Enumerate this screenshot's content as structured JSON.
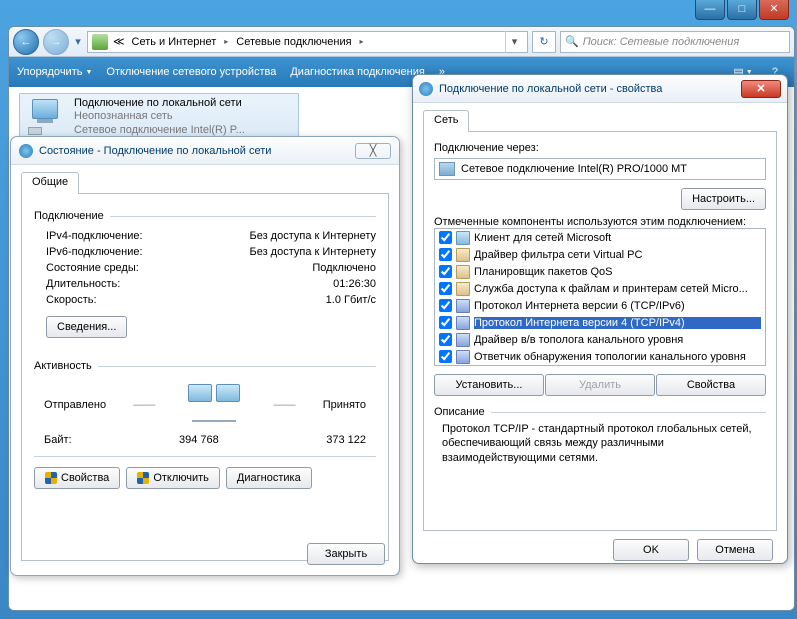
{
  "titlebar": {
    "min": "—",
    "max": "□",
    "close": "✕"
  },
  "nav": {
    "back": "←",
    "fwd": "→",
    "drop": "▾",
    "bc_icon_glyph": "≪",
    "bc1": "Сеть и Интернет",
    "bc2": "Сетевые подключения",
    "bc_drop": "▾",
    "refresh": "↻",
    "search_placeholder": "Поиск: Сетевые подключения",
    "search_icon": "🔍"
  },
  "toolbar": {
    "organize": "Упорядочить",
    "disable": "Отключение сетевого устройства",
    "diag": "Диагностика подключения",
    "more": "»",
    "view_icon": "▤",
    "help_icon": "?"
  },
  "tile": {
    "title": "Подключение по локальной сети",
    "sub": "Неопознанная сеть",
    "adapter": "Сетевое подключение Intel(R) P..."
  },
  "status": {
    "title": "Состояние - Подключение по локальной сети",
    "close_x": "╳",
    "tab_general": "Общие",
    "group_conn": "Подключение",
    "ipv4_k": "IPv4-подключение:",
    "ipv4_v": "Без доступа к Интернету",
    "ipv6_k": "IPv6-подключение:",
    "ipv6_v": "Без доступа к Интернету",
    "media_k": "Состояние среды:",
    "media_v": "Подключено",
    "dur_k": "Длительность:",
    "dur_v": "01:26:30",
    "speed_k": "Скорость:",
    "speed_v": "1.0 Гбит/с",
    "details": "Сведения...",
    "group_act": "Активность",
    "sent": "Отправлено",
    "recv": "Принято",
    "bytes_k": "Байт:",
    "bytes_sent": "394 768",
    "bytes_recv": "373 122",
    "btn_props": "Свойства",
    "btn_disable": "Отключить",
    "btn_diag": "Диагностика",
    "btn_close": "Закрыть"
  },
  "props": {
    "title": "Подключение по локальной сети - свойства",
    "close_x": "✕",
    "tab_net": "Сеть",
    "connect_via": "Подключение через:",
    "adapter": "Сетевое подключение Intel(R) PRO/1000 MT",
    "configure": "Настроить...",
    "components_label": "Отмеченные компоненты используются этим подключением:",
    "items": [
      {
        "label": "Клиент для сетей Microsoft",
        "kind": "mon",
        "checked": true,
        "selected": false
      },
      {
        "label": "Драйвер фильтра сети Virtual PC",
        "kind": "svc",
        "checked": true,
        "selected": false
      },
      {
        "label": "Планировщик пакетов QoS",
        "kind": "svc",
        "checked": true,
        "selected": false
      },
      {
        "label": "Служба доступа к файлам и принтерам сетей Micro...",
        "kind": "svc",
        "checked": true,
        "selected": false
      },
      {
        "label": "Протокол Интернета версии 6 (TCP/IPv6)",
        "kind": "proto",
        "checked": true,
        "selected": false
      },
      {
        "label": "Протокол Интернета версии 4 (TCP/IPv4)",
        "kind": "proto",
        "checked": true,
        "selected": true
      },
      {
        "label": "Драйвер в/в тополога канального уровня",
        "kind": "proto",
        "checked": true,
        "selected": false
      },
      {
        "label": "Ответчик обнаружения топологии канального уровня",
        "kind": "proto",
        "checked": true,
        "selected": false
      }
    ],
    "install": "Установить...",
    "remove": "Удалить",
    "properties": "Свойства",
    "desc_label": "Описание",
    "desc_text": "Протокол TCP/IP - стандартный протокол глобальных сетей, обеспечивающий связь между различными взаимодействующими сетями.",
    "ok": "OK",
    "cancel": "Отмена"
  }
}
